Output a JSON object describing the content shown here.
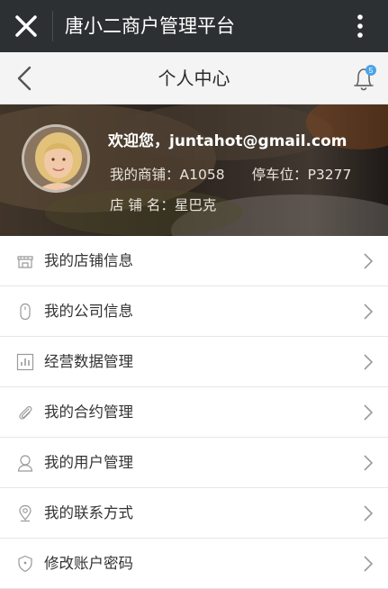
{
  "wechat_bar": {
    "title": "唐小二商户管理平台",
    "close_icon": "close-icon",
    "more_icon": "more-vertical-icon"
  },
  "nav": {
    "title": "个人中心",
    "back_icon": "back-arrow-icon",
    "bell_icon": "bell-icon",
    "notification_count": "5"
  },
  "profile": {
    "welcome": "欢迎您，juntahot@gmail.com",
    "shop_label": "我的商铺：A1058",
    "parking_label": "停车位：P3277",
    "store_name_label": "店 铺 名：星巴克"
  },
  "menu": {
    "items": [
      {
        "label": "我的店铺信息",
        "icon": "store-icon"
      },
      {
        "label": "我的公司信息",
        "icon": "mouse-icon"
      },
      {
        "label": "经营数据管理",
        "icon": "bar-chart-icon"
      },
      {
        "label": "我的合约管理",
        "icon": "paperclip-icon"
      },
      {
        "label": "我的用户管理",
        "icon": "user-icon"
      },
      {
        "label": "我的联系方式",
        "icon": "location-pin-icon"
      },
      {
        "label": "修改账户密码",
        "icon": "shield-icon"
      }
    ]
  },
  "colors": {
    "wechat_bar": "#2d3032",
    "nav_bg": "#f4f4f4",
    "badge": "#4aa3e8"
  }
}
